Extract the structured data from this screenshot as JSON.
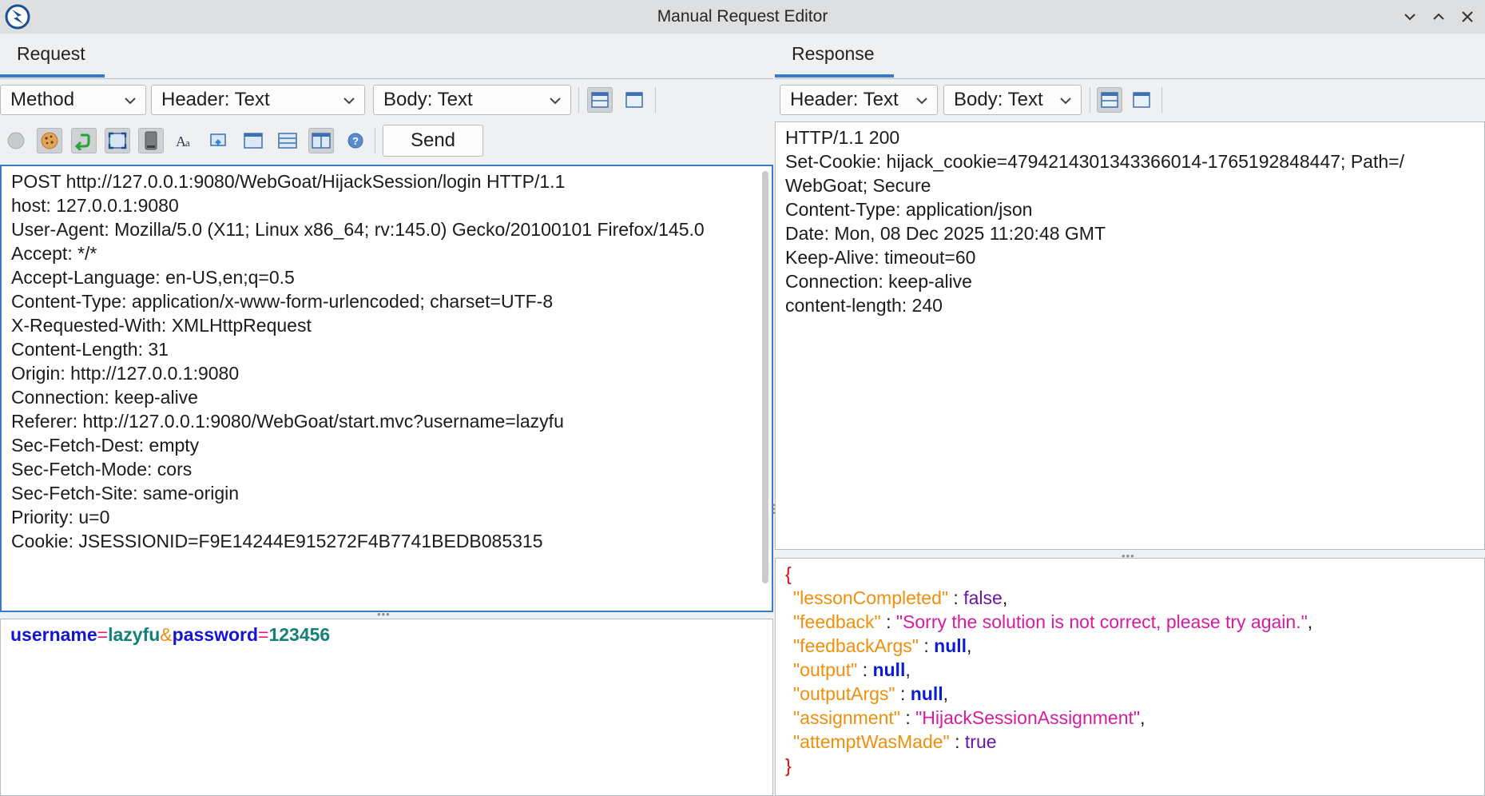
{
  "window": {
    "title": "Manual Request Editor"
  },
  "request": {
    "tab_label": "Request",
    "method_combo": "Method",
    "header_combo": "Header: Text",
    "body_combo": "Body: Text",
    "send_label": "Send",
    "header_lines": [
      "POST http://127.0.0.1:9080/WebGoat/HijackSession/login HTTP/1.1",
      "host: 127.0.0.1:9080",
      "User-Agent: Mozilla/5.0 (X11; Linux x86_64; rv:145.0) Gecko/20100101 Firefox/145.0",
      "Accept: */*",
      "Accept-Language: en-US,en;q=0.5",
      "Content-Type: application/x-www-form-urlencoded; charset=UTF-8",
      "X-Requested-With: XMLHttpRequest",
      "Content-Length: 31",
      "Origin: http://127.0.0.1:9080",
      "Connection: keep-alive",
      "Referer: http://127.0.0.1:9080/WebGoat/start.mvc?username=lazyfu",
      "Sec-Fetch-Dest: empty",
      "Sec-Fetch-Mode: cors",
      "Sec-Fetch-Site: same-origin",
      "Priority: u=0",
      "Cookie: JSESSIONID=F9E14244E915272F4B7741BEDB085315"
    ],
    "body": {
      "k1": "username",
      "eq": "=",
      "v1": "lazyfu",
      "amp": "&",
      "k2": "password",
      "v2": "123456"
    }
  },
  "response": {
    "tab_label": "Response",
    "header_combo": "Header: Text",
    "body_combo": "Body: Text",
    "header_lines": [
      "HTTP/1.1 200",
      "Set-Cookie: hijack_cookie=4794214301343366014-1765192848447; Path=/",
      "WebGoat; Secure",
      "Content-Type: application/json",
      "Date: Mon, 08 Dec 2025 11:20:48 GMT",
      "Keep-Alive: timeout=60",
      "Connection: keep-alive",
      "content-length: 240"
    ],
    "json": {
      "open": "{",
      "close": "}",
      "sep": " : ",
      "comma": ",",
      "rows": [
        {
          "key": "\"lessonCompleted\"",
          "value": "false",
          "kind": "bool"
        },
        {
          "key": "\"feedback\"",
          "value": "\"Sorry the solution is not correct, please try again.\"",
          "kind": "str"
        },
        {
          "key": "\"feedbackArgs\"",
          "value": "null",
          "kind": "null"
        },
        {
          "key": "\"output\"",
          "value": "null",
          "kind": "null"
        },
        {
          "key": "\"outputArgs\"",
          "value": "null",
          "kind": "null"
        },
        {
          "key": "\"assignment\"",
          "value": "\"HijackSessionAssignment\"",
          "kind": "str"
        },
        {
          "key": "\"attemptWasMade\"",
          "value": "true",
          "kind": "bool"
        }
      ]
    }
  },
  "icons": {
    "app": "zap-app-icon",
    "toolbar": [
      "stop-icon",
      "cookie-icon",
      "follow-redirect-icon",
      "fullscreen-icon",
      "trash-icon",
      "font-icon",
      "refresh-icon",
      "window-icon",
      "layout-horizontal-icon",
      "layout-split-icon",
      "help-icon"
    ]
  }
}
